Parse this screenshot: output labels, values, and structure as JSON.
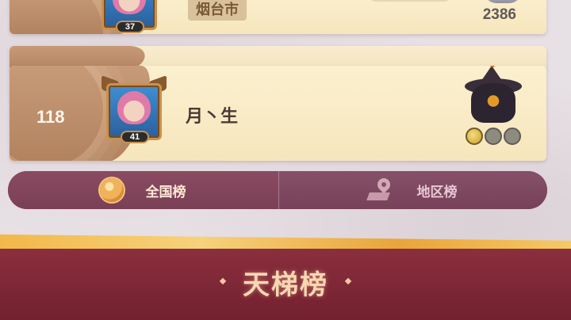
{
  "top_entry": {
    "level": "37",
    "region": "烟台市",
    "score": "2386"
  },
  "main_entry": {
    "rank": "118",
    "level": "41",
    "name": "月丶生"
  },
  "tabs": {
    "national_label": "全国榜",
    "regional_label": "地区榜"
  },
  "footer": {
    "title": "天梯榜"
  },
  "colors": {
    "card_bg": "#f6e6bd",
    "rank_panel": "#b3835f",
    "tab_bar": "#7d4258",
    "banner_wine": "#73202f",
    "banner_gold": "#f2b84a"
  }
}
